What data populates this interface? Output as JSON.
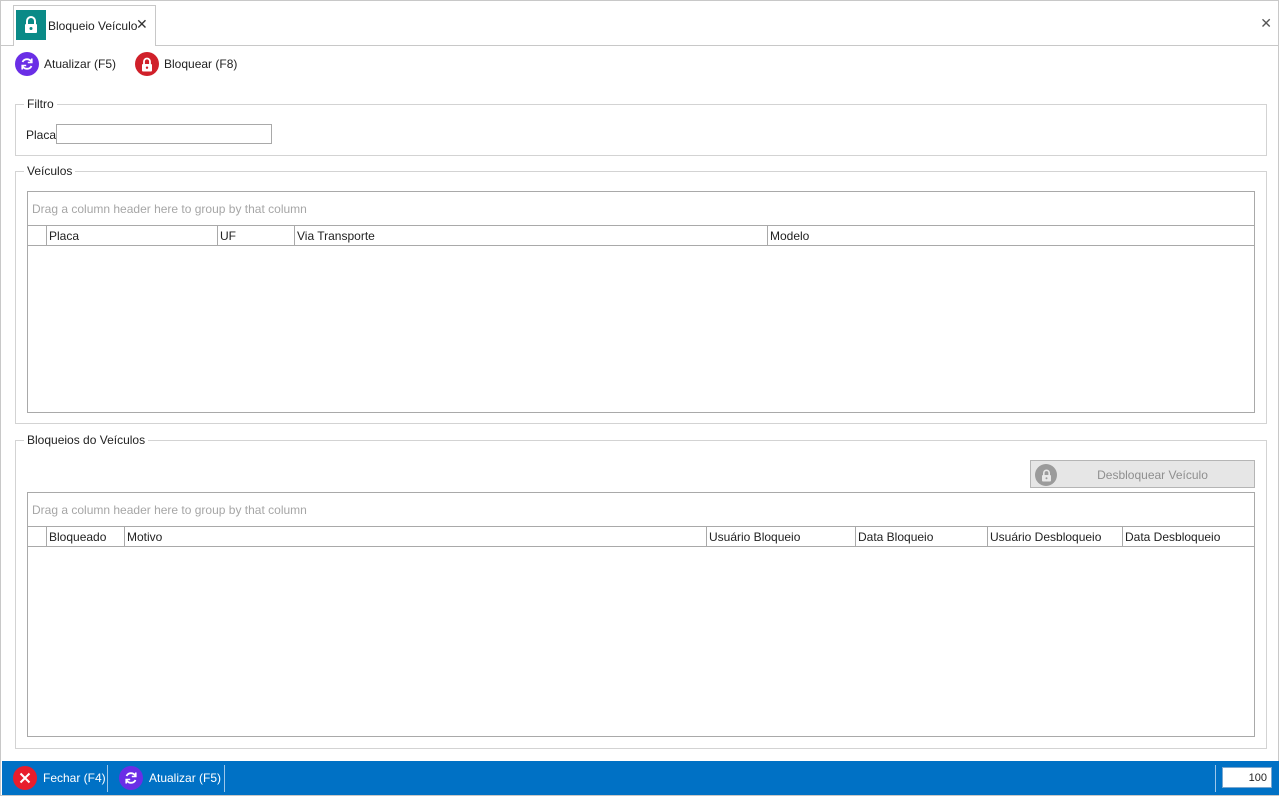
{
  "tab": {
    "title": "Bloqueio Veículo",
    "close_glyph": "✕",
    "icon": "lock-icon",
    "icon_bg": "#0a8a87"
  },
  "window": {
    "close_glyph": "✕"
  },
  "toolbar": {
    "refresh_label": "Atualizar (F5)",
    "block_label": "Bloquear (F8)"
  },
  "filter": {
    "title": "Filtro",
    "plate_label": "Placa",
    "plate_value": ""
  },
  "vehicles": {
    "title": "Veículos",
    "group_panel_text": "Drag a column header here to group by that column",
    "columns": [
      "Placa",
      "UF",
      "Via Transporte",
      "Modelo"
    ]
  },
  "blocks": {
    "title": "Bloqueios do Veículos",
    "unlock_label": "Desbloquear Veículo",
    "group_panel_text": "Drag a column header here to group by that column",
    "columns": [
      "Bloqueado",
      "Motivo",
      "Usuário Bloqueio",
      "Data Bloqueio",
      "Usuário Desbloqueio",
      "Data Desbloqueio"
    ]
  },
  "footer": {
    "close_label": "Fechar (F4)",
    "refresh_label": "Atualizar (F5)",
    "zoom": "100",
    "bar_color": "#0071c5"
  },
  "colors": {
    "accent_purple": "#6a2ee6",
    "accent_red": "#d0202a",
    "teal": "#0a8a87"
  }
}
